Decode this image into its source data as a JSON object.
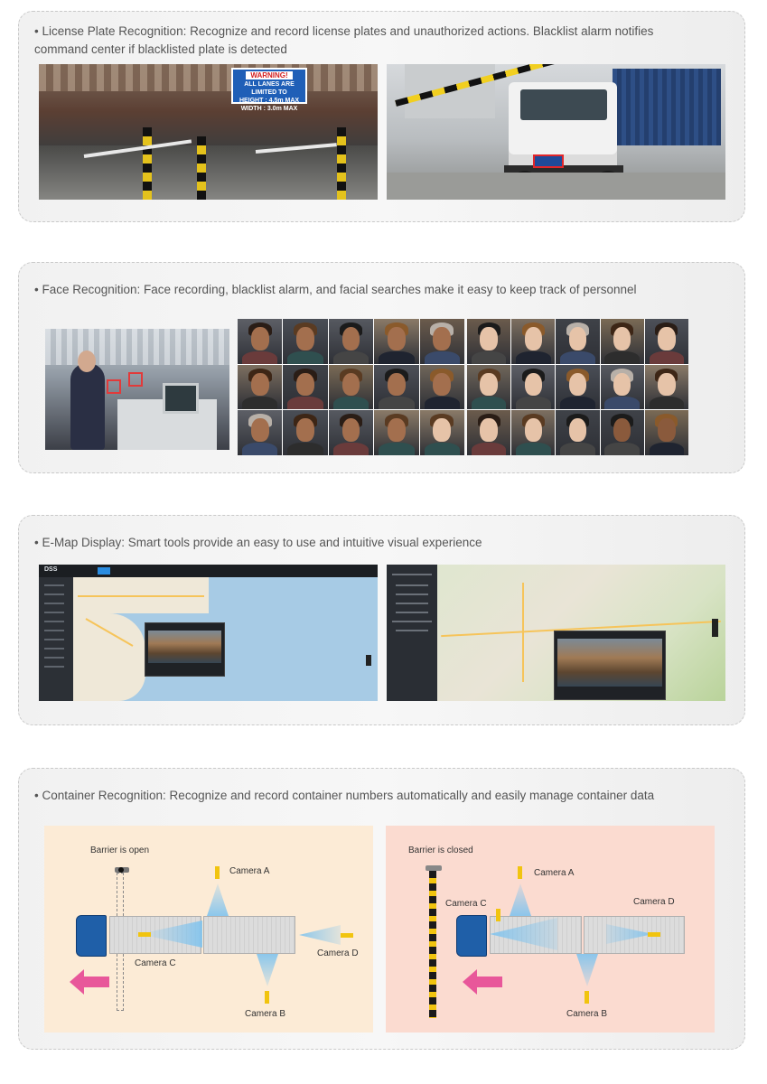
{
  "sections": {
    "license": {
      "text": "• License Plate Recognition: Recognize and record license plates and unauthorized actions. Blacklist alarm notifies command center if blacklisted plate is detected",
      "sign_title": "WARNING!",
      "sign_line1": "ALL LANES ARE LIMITED TO",
      "sign_line2": "HEIGHT    : 4.5m MAX",
      "sign_line3": "WIDTH     : 3.0m MAX"
    },
    "face": {
      "text": "• Face Recognition: Face recording, blacklist alarm, and facial searches make it easy to keep track of personnel"
    },
    "emap": {
      "text": "• E-Map Display: Smart tools provide an easy to use and intuitive visual experience",
      "app_logo": "DSS"
    },
    "container": {
      "text": "• Container Recognition: Recognize and record container numbers automatically and easily manage container data",
      "open_title": "Barrier is open",
      "closed_title": "Barrier is closed",
      "camera_a": "Camera A",
      "camera_b": "Camera B",
      "camera_c": "Camera C",
      "camera_d": "Camera D"
    }
  },
  "colors": {
    "card_border": "#c9c9c9",
    "open_pane": "#fcebd6",
    "closed_pane": "#fbdbd0",
    "camera_yellow": "#f1c40f",
    "arrow_pink": "#e8579a",
    "beam_blue": "#7fc3ee",
    "truck_blue": "#1f5fa8"
  }
}
